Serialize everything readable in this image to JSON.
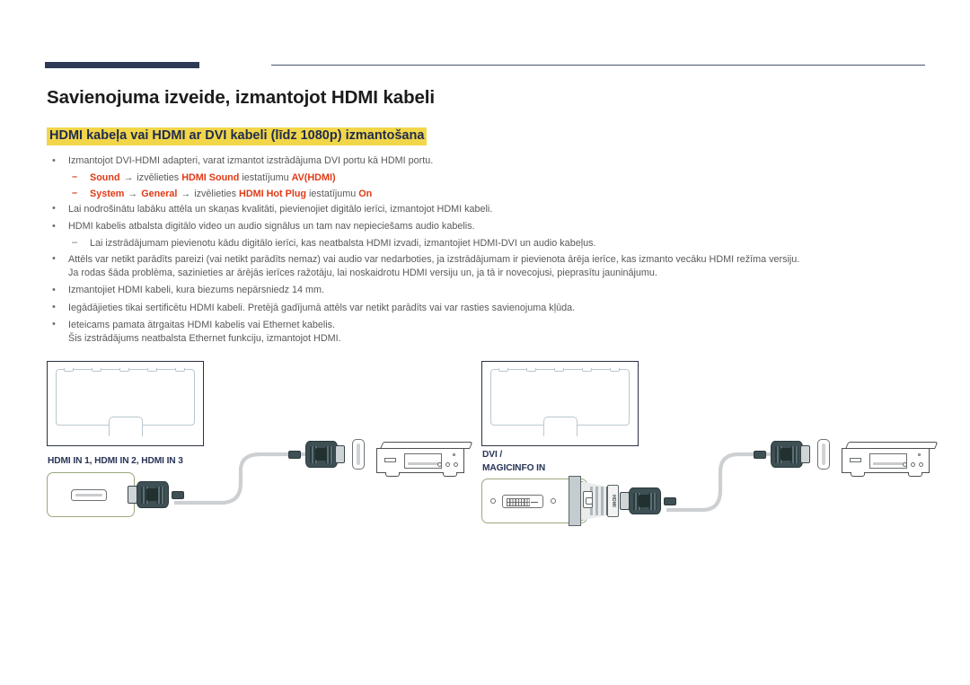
{
  "header": {
    "rule_color": "#2e3a55"
  },
  "title": "Savienojuma izveide, izmantojot HDMI kabeli",
  "subtitle": "HDMI kabeļa vai HDMI ar DVI kabeli (līdz 1080p) izmantošana",
  "subtitle_highlight_color": "#f2d64a",
  "accent_red": "#e03a16",
  "bullets": [
    {
      "mark": "•",
      "text": "Izmantojot DVI-HDMI adapteri, varat izmantot izstrādājuma DVI portu kā HDMI portu."
    },
    {
      "mark": "–",
      "sub": true,
      "rich": [
        {
          "t": "Sound",
          "red": true
        },
        {
          "t": " → ",
          "red": false
        },
        {
          "t": "izvēlieties ",
          "red": false
        },
        {
          "t": "HDMI Sound",
          "red": true
        },
        {
          "t": " iestatījumu ",
          "red": false
        },
        {
          "t": "AV(HDMI)",
          "red": true
        }
      ]
    },
    {
      "mark": "–",
      "sub": true,
      "rich": [
        {
          "t": "System",
          "red": true
        },
        {
          "t": " → ",
          "red": false
        },
        {
          "t": "General",
          "red": true
        },
        {
          "t": " → ",
          "red": false
        },
        {
          "t": "izvēlieties ",
          "red": false
        },
        {
          "t": "HDMI Hot Plug",
          "red": true
        },
        {
          "t": " iestatījumu ",
          "red": false
        },
        {
          "t": "On",
          "red": true
        }
      ]
    },
    {
      "mark": "•",
      "text": "Lai nodrošinātu labāku attēla un skaņas kvalitāti, pievienojiet digitālo ierīci, izmantojot HDMI kabeli."
    },
    {
      "mark": "•",
      "text": "HDMI kabelis atbalsta digitālo video un audio signālus un tam nav nepieciešams audio kabelis."
    },
    {
      "mark": "–",
      "sub": true,
      "plain": true,
      "text": "Lai izstrādājumam pievienotu kādu digitālo ierīci, kas neatbalsta HDMI izvadi, izmantojiet HDMI-DVI un audio kabeļus."
    },
    {
      "mark": "•",
      "text": "Attēls var netikt parādīts pareizi (vai netikt parādīts nemaz) vai audio var nedarboties, ja izstrādājumam ir pievienota ārēja ierīce, kas izmanto vecāku HDMI režīma versiju.",
      "cont": "Ja rodas šāda problēma, sazinieties ar ārējās ierīces ražotāju, lai noskaidrotu HDMI versiju un, ja tā ir novecojusi, pieprasītu jauninājumu."
    },
    {
      "mark": "•",
      "text": "Izmantojiet HDMI kabeli, kura biezums nepārsniedz 14 mm."
    },
    {
      "mark": "•",
      "text": "Iegādājieties tikai sertificētu HDMI kabeli. Pretējā gadījumā attēls var netikt parādīts vai var rasties savienojuma kļūda."
    },
    {
      "mark": "•",
      "text": "Ieteicams pamata ātrgaitas HDMI kabelis vai Ethernet kabelis.",
      "cont": "Šis izstrādājums neatbalsta Ethernet funkciju, izmantojot HDMI."
    }
  ],
  "diagrams": {
    "left": {
      "port_label": "HDMI IN 1, HDMI IN 2, HDMI IN 3",
      "port_type": "hdmi",
      "port_box_color": "#9aa87e"
    },
    "right": {
      "port_label_line1": "DVI /",
      "port_label_line2": "MAGICINFO IN",
      "port_type": "dvi",
      "port_box_color": "#9aa87e",
      "adapter_label": "HDMI"
    }
  }
}
